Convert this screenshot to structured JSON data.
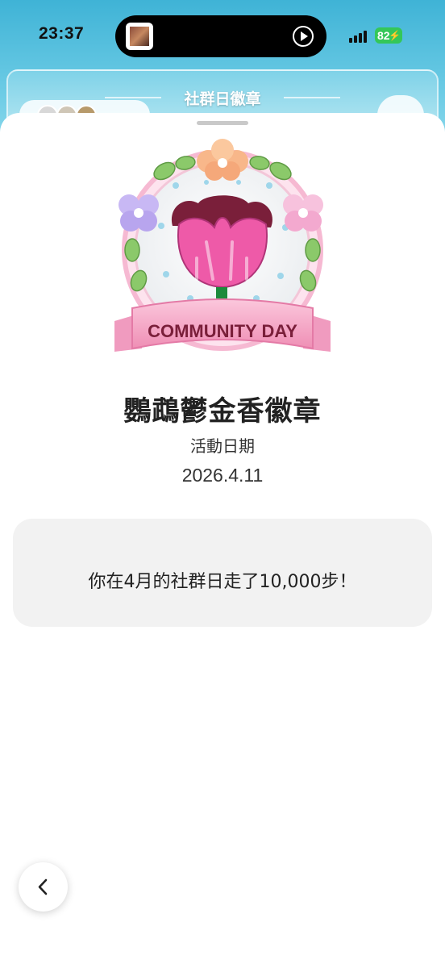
{
  "status_bar": {
    "time": "23:37",
    "battery": "82"
  },
  "app_header": {
    "title": "社群日徽章"
  },
  "badge": {
    "banner_text": "COMMUNITY DAY",
    "name": "鸚鵡鬱金香徽章",
    "date_label": "活動日期",
    "date_value": "2026.4.11"
  },
  "message": {
    "text": "你在4月的社群日走了10,000步！"
  },
  "icons": {
    "back": "chevron-left-icon",
    "play": "play-icon",
    "settings": "gear-icon"
  },
  "colors": {
    "sky": "#3fb3d6",
    "card_bg": "#f2f2f2",
    "tulip_pink": "#ee5aa8",
    "ribbon_pink": "#f7a9c8",
    "battery_green": "#34c759"
  }
}
